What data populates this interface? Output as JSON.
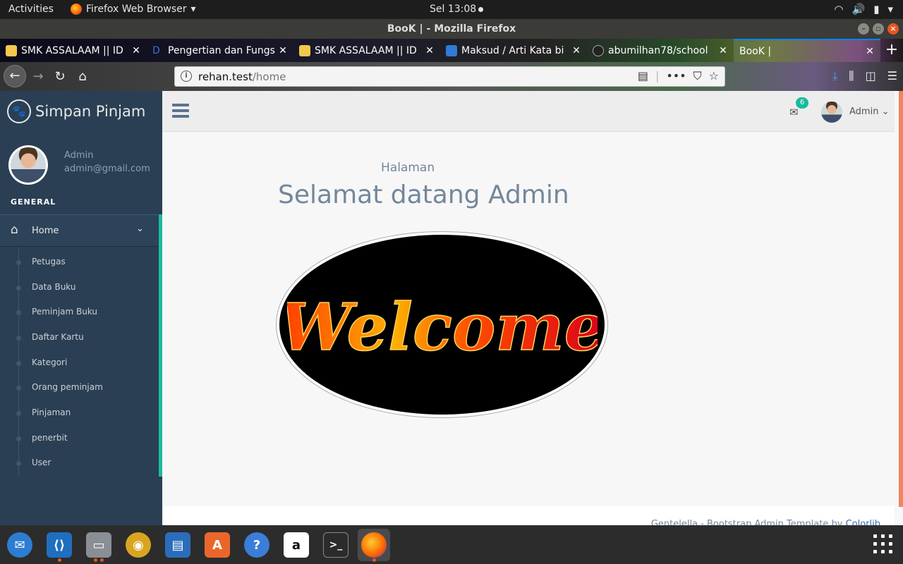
{
  "topbar": {
    "activities": "Activities",
    "app_name": "Firefox Web Browser",
    "clock": "Sel 13:08"
  },
  "window": {
    "title": "BooK | - Mozilla Firefox"
  },
  "tabs": [
    {
      "label": "SMK ASSALAAM || ID",
      "icon_color": "#f2c94c"
    },
    {
      "label": "Pengertian dan Fungs",
      "icon_color": "#3b6fd4"
    },
    {
      "label": "SMK ASSALAAM || ID",
      "icon_color": "#f2c94c"
    },
    {
      "label": "Maksud / Arti Kata bi",
      "icon_color": "#2f7bd6"
    },
    {
      "label": "abumilhan78/school",
      "icon_color": "#222222"
    },
    {
      "label": "BooK |",
      "icon_color": "#bbbbbb"
    }
  ],
  "navbar": {
    "url_host": "rehan.test",
    "url_path": "/home"
  },
  "sidebar": {
    "brand": "Simpan Pinjam",
    "user_name": "Admin",
    "user_email": "admin@gmail.com",
    "section": "GENERAL",
    "home_label": "Home",
    "items": [
      {
        "label": "Petugas"
      },
      {
        "label": "Data Buku"
      },
      {
        "label": "Peminjam Buku"
      },
      {
        "label": "Daftar Kartu"
      },
      {
        "label": "Kategori"
      },
      {
        "label": "Orang peminjam"
      },
      {
        "label": "Pinjaman"
      },
      {
        "label": "penerbit"
      },
      {
        "label": "User"
      }
    ]
  },
  "topnav": {
    "mail_count": "6",
    "user": "Admin"
  },
  "content": {
    "subtitle": "Halaman",
    "title": "Selamat datang Admin",
    "image_text": "Welcome"
  },
  "footer": {
    "text": "Gentelella - Bootstrap Admin Template by ",
    "link": "Colorlib"
  },
  "colors": {
    "sidebar_bg": "#2a3f54",
    "accent": "#1abb9c",
    "text_muted": "#73879c",
    "ubuntu_orange": "#e95420"
  },
  "dock": [
    {
      "name": "thunderbird",
      "color": "#2d7dd2"
    },
    {
      "name": "vscode",
      "color": "#1f6fbf"
    },
    {
      "name": "files",
      "color": "#8a8f96"
    },
    {
      "name": "rhythmbox",
      "color": "#d9a520"
    },
    {
      "name": "libreoffice-writer",
      "color": "#2a6dbb"
    },
    {
      "name": "software-center",
      "color": "#e9672b"
    },
    {
      "name": "help",
      "color": "#3b7dd8"
    },
    {
      "name": "amazon",
      "color": "#ffffff"
    },
    {
      "name": "terminal",
      "color": "#2b2b2b"
    },
    {
      "name": "firefox",
      "color": "#ff7b1c"
    }
  ]
}
